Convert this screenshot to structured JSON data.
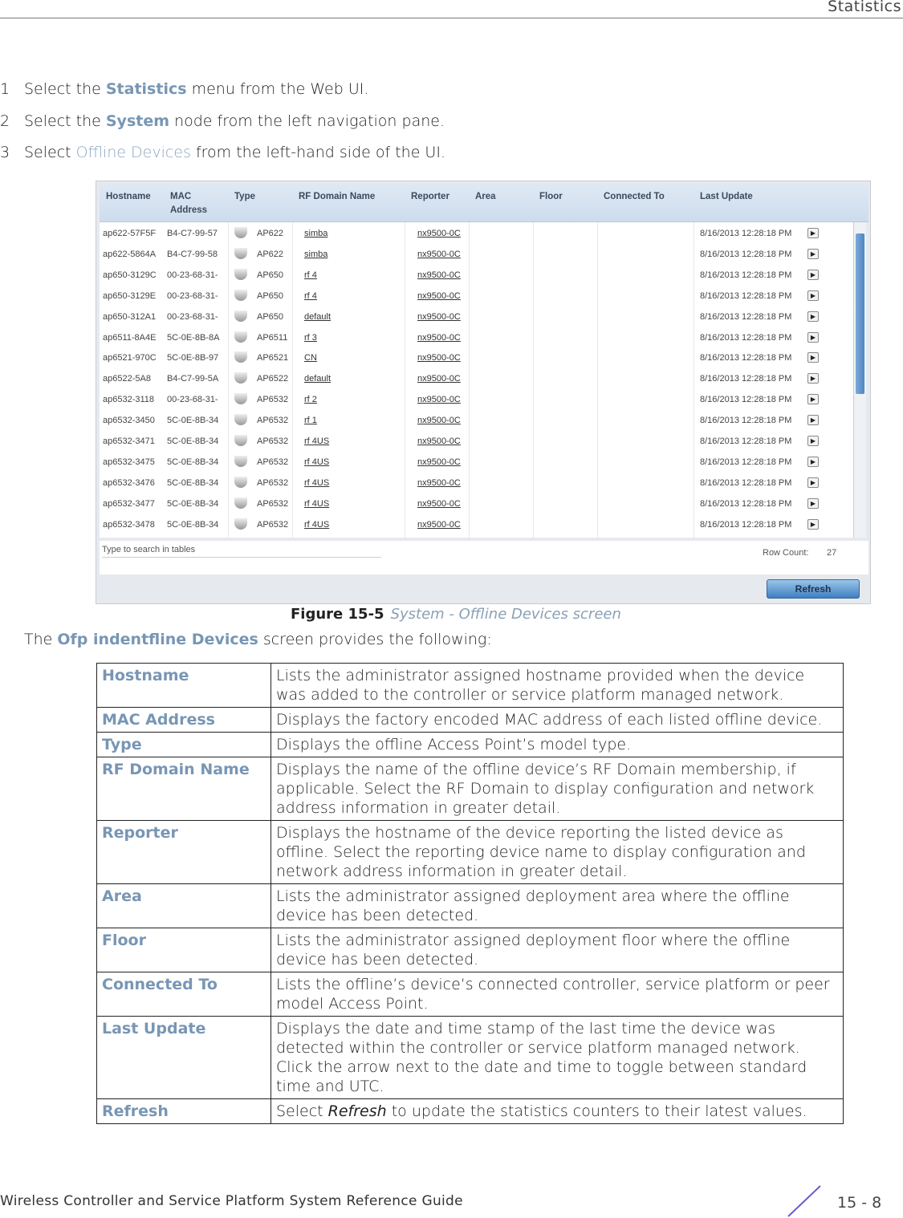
{
  "header": {
    "section": "Statistics"
  },
  "steps": [
    {
      "num": "1",
      "pre": "Select the ",
      "em": "Statistics",
      "post": " menu from the Web UI."
    },
    {
      "num": "2",
      "pre": "Select the ",
      "em": "System",
      "post": " node from the left navigation pane."
    },
    {
      "num": "3",
      "pre": "Select ",
      "em": "Offline Devices",
      "post": " from the left-hand side of the UI."
    }
  ],
  "screenshot": {
    "columns": [
      "Hostname",
      "MAC Address",
      "Type",
      "RF Domain Name",
      "Reporter",
      "Area",
      "Floor",
      "Connected To",
      "Last Update"
    ],
    "rows": [
      [
        "ap622-57F5F",
        "B4-C7-99-57",
        "AP622",
        "simba",
        "nx9500-0C"
      ],
      [
        "ap622-5864A",
        "B4-C7-99-58",
        "AP622",
        "simba",
        "nx9500-0C"
      ],
      [
        "ap650-3129C",
        "00-23-68-31-",
        "AP650",
        "rf 4",
        "nx9500-0C"
      ],
      [
        "ap650-3129E",
        "00-23-68-31-",
        "AP650",
        "rf 4",
        "nx9500-0C"
      ],
      [
        "ap650-312A1",
        "00-23-68-31-",
        "AP650",
        "default",
        "nx9500-0C"
      ],
      [
        "ap6511-8A4E",
        "5C-0E-8B-8A",
        "AP6511",
        "rf 3",
        "nx9500-0C"
      ],
      [
        "ap6521-970C",
        "5C-0E-8B-97",
        "AP6521",
        "CN",
        "nx9500-0C"
      ],
      [
        "ap6522-5A8",
        "B4-C7-99-5A",
        "AP6522",
        "default",
        "nx9500-0C"
      ],
      [
        "ap6532-3118",
        "00-23-68-31-",
        "AP6532",
        "rf 2",
        "nx9500-0C"
      ],
      [
        "ap6532-3450",
        "5C-0E-8B-34",
        "AP6532",
        "rf 1",
        "nx9500-0C"
      ],
      [
        "ap6532-3471",
        "5C-0E-8B-34",
        "AP6532",
        "rf 4US",
        "nx9500-0C"
      ],
      [
        "ap6532-3475",
        "5C-0E-8B-34",
        "AP6532",
        "rf 4US",
        "nx9500-0C"
      ],
      [
        "ap6532-3476",
        "5C-0E-8B-34",
        "AP6532",
        "rf 4US",
        "nx9500-0C"
      ],
      [
        "ap6532-3477",
        "5C-0E-8B-34",
        "AP6532",
        "rf 4US",
        "nx9500-0C"
      ],
      [
        "ap6532-3478",
        "5C-0E-8B-34",
        "AP6532",
        "rf 4US",
        "nx9500-0C"
      ]
    ],
    "last_update": "8/16/2013 12:28:18 PM",
    "search_placeholder": "Type to search in tables",
    "row_count_label": "Row Count:",
    "row_count": "27",
    "refresh_label": "Refresh"
  },
  "figure": {
    "label": "Figure 15-5",
    "caption": "System - Offline Devices screen"
  },
  "intro": {
    "pre": "The ",
    "em": "Ofp indentfline Devices",
    "post": " screen provides the following:"
  },
  "definitions": [
    {
      "term": "Hostname",
      "desc": "Lists the administrator assigned hostname provided when the device was added to the controller or service platform managed network."
    },
    {
      "term": "MAC Address",
      "desc": "Displays the factory encoded MAC address of each listed offline device."
    },
    {
      "term": "Type",
      "desc": "Displays the offline Access Point’s model type."
    },
    {
      "term": "RF Domain Name",
      "desc": "Displays the name of the offline device’s RF Domain membership, if applicable. Select the RF Domain to display configuration and network address information in greater detail."
    },
    {
      "term": "Reporter",
      "desc": "Displays the hostname of the device reporting the listed device as offline. Select the reporting device name to display configuration and network address information in greater detail."
    },
    {
      "term": "Area",
      "desc": "Lists the administrator assigned deployment area where the offline device has been detected."
    },
    {
      "term": "Floor",
      "desc": "Lists the administrator assigned deployment floor where the offline device has been detected."
    },
    {
      "term": "Connected To",
      "desc": "Lists the offline’s device’s connected controller, service platform or peer model Access Point."
    },
    {
      "term": "Last Update",
      "desc": "Displays the date and time stamp of the last time the device was detected within the controller or service platform managed network. Click the arrow next to the date and time to toggle between standard time and UTC."
    },
    {
      "term": "Refresh",
      "desc_pre": "Select ",
      "desc_em": "Refresh",
      "desc_post": " to update the statistics counters to their latest values."
    }
  ],
  "footer": {
    "guide": "Wireless Controller and Service Platform System Reference Guide",
    "page": "15 - 8"
  }
}
